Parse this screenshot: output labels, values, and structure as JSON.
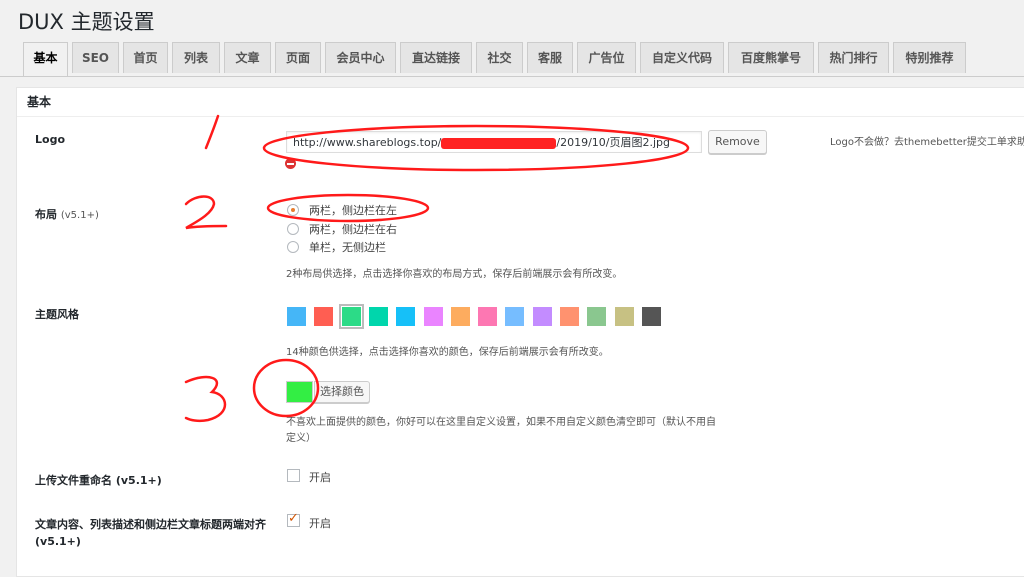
{
  "page": {
    "title": "DUX 主题设置"
  },
  "tabs": [
    {
      "label": "基本",
      "active": true
    },
    {
      "label": "SEO"
    },
    {
      "label": "首页"
    },
    {
      "label": "列表"
    },
    {
      "label": "文章"
    },
    {
      "label": "页面"
    },
    {
      "label": "会员中心"
    },
    {
      "label": "直达链接"
    },
    {
      "label": "社交"
    },
    {
      "label": "客服"
    },
    {
      "label": "广告位"
    },
    {
      "label": "自定义代码"
    },
    {
      "label": "百度熊掌号"
    },
    {
      "label": "热门排行"
    },
    {
      "label": "特别推荐"
    }
  ],
  "section": {
    "title": "基本"
  },
  "logo": {
    "label": "Logo",
    "url_prefix": "http://www.shareblogs.top/",
    "url_suffix": "/2019/10/页眉图2.jpg",
    "remove_label": "Remove",
    "help": "Logo不会做？去themebetter提交工单求助"
  },
  "layout": {
    "label": "布局",
    "version": "(v5.1+)",
    "options": [
      "两栏，侧边栏在左",
      "两栏，侧边栏在右",
      "单栏，无侧边栏"
    ],
    "selected_index": 0,
    "desc": "2种布局供选择，点击选择你喜欢的布局方式，保存后前端展示会有所改变。"
  },
  "theme": {
    "label": "主题风格",
    "swatches": [
      "#45b6f7",
      "#ff5e52",
      "#2cdb87",
      "#00d6ac",
      "#16c0f8",
      "#ea84ff",
      "#fdac5f",
      "#fd77b2",
      "#76bdff",
      "#c38cff",
      "#ff926f",
      "#8ac78f",
      "#c7c183",
      "#555555"
    ],
    "selected_index": 2,
    "desc": "14种颜色供选择，点击选择你喜欢的颜色，保存后前端展示会有所改变。",
    "custom_color": "#33ee44",
    "custom_button": "选择颜色",
    "custom_desc_line1": "不喜欢上面提供的颜色，你好可以在这里自定义设置，如果不用自定义颜色清空即可（默认不用自",
    "custom_desc_line2": "定义）"
  },
  "rename": {
    "label": "上传文件重命名",
    "version": "(v5.1+)",
    "option": "开启",
    "checked": false
  },
  "justify": {
    "label": "文章内容、列表描述和侧边栏文章标题两端对齐",
    "version": "(v5.1+)",
    "option": "开启",
    "checked": true
  },
  "colors": {
    "annotation": "#ff1a1a",
    "redaction": "#ff2222",
    "remove_icon": "#dc3232"
  }
}
